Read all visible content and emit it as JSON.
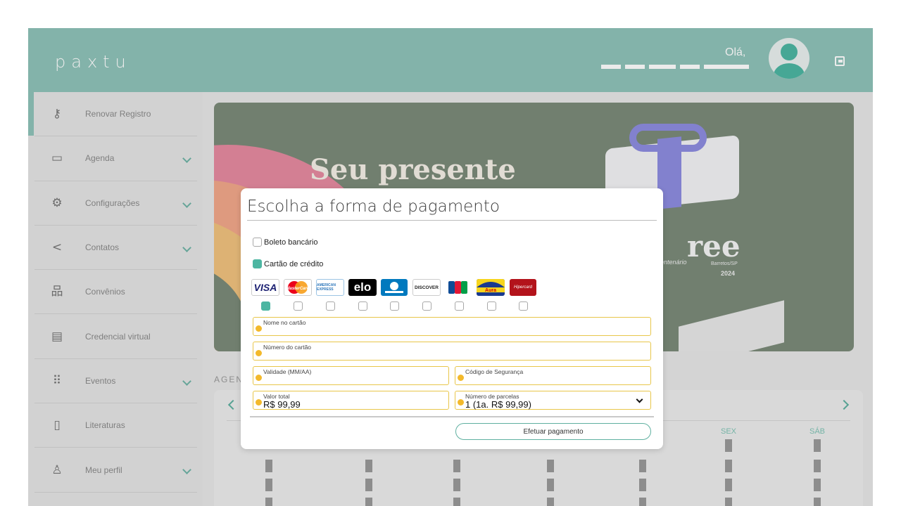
{
  "app": {
    "logo": "paxtu"
  },
  "header": {
    "greeting": "Olá,"
  },
  "sidebar": {
    "items": [
      {
        "label": "Renovar Registro",
        "icon": "key-icon",
        "glyph": "⚷",
        "expandable": false,
        "active": true
      },
      {
        "label": "Agenda",
        "icon": "calendar-icon",
        "glyph": "▭",
        "expandable": true
      },
      {
        "label": "Configurações",
        "icon": "gear-icon",
        "glyph": "⚙",
        "expandable": true
      },
      {
        "label": "Contatos",
        "icon": "share-icon",
        "glyph": "<",
        "expandable": true
      },
      {
        "label": "Convênios",
        "icon": "hierarchy-icon",
        "glyph": "品",
        "expandable": false
      },
      {
        "label": "Credencial virtual",
        "icon": "inbox-icon",
        "glyph": "▤",
        "expandable": false
      },
      {
        "label": "Eventos",
        "icon": "grid-icon",
        "glyph": "⠿",
        "expandable": true
      },
      {
        "label": "Literaturas",
        "icon": "book-icon",
        "glyph": "▯",
        "expandable": false
      },
      {
        "label": "Meu perfil",
        "icon": "user-icon",
        "glyph": "♙",
        "expandable": true
      }
    ]
  },
  "banner": {
    "title": "Seu presente",
    "brand": "ree",
    "sub1": "entenário",
    "sub2": "Barretos/SP",
    "sub3": "2024",
    "colors": {
      "background": "#7b8a79",
      "arc_pink": "#e58aa0",
      "arc_orange": "#f1a88a",
      "arc_yellow": "#f0c27e",
      "ribbon": "#8e8ce0"
    }
  },
  "agenda": {
    "title": "AGEN",
    "days": [
      "SEX",
      "SÁB"
    ]
  },
  "modal": {
    "title": "Escolha a forma de pagamento",
    "options": [
      {
        "label": "Boleto bancário",
        "checked": false
      },
      {
        "label": "Cartão de crédito",
        "checked": true
      }
    ],
    "card_brands": [
      {
        "name": "VISA",
        "icon": "visa-icon",
        "selected": true
      },
      {
        "name": "MasterCard",
        "icon": "mastercard-icon",
        "selected": false
      },
      {
        "name": "AMERICAN EXPRESS",
        "icon": "amex-icon",
        "selected": false
      },
      {
        "name": "elo",
        "icon": "elo-icon",
        "selected": false
      },
      {
        "name": "Diners Club",
        "icon": "diners-icon",
        "selected": false
      },
      {
        "name": "DISCOVER",
        "icon": "discover-icon",
        "selected": false
      },
      {
        "name": "JCB",
        "icon": "jcb-icon",
        "selected": false
      },
      {
        "name": "Aura",
        "icon": "aura-icon",
        "selected": false
      },
      {
        "name": "Hipercard",
        "icon": "hipercard-icon",
        "selected": false
      }
    ],
    "fields": {
      "card_name": {
        "label": "Nome no cartão",
        "value": ""
      },
      "card_number": {
        "label": "Número do cartão",
        "value": ""
      },
      "expiry": {
        "label": "Validade (MM/AA)",
        "value": ""
      },
      "cvv": {
        "label": "Código de Segurança",
        "value": ""
      },
      "total": {
        "label": "Valor total",
        "value": "R$ 99,99"
      },
      "installments": {
        "label": "Número de parcelas",
        "value": "1 (1a. R$ 99,99)"
      }
    },
    "pay_button": "Efetuar pagamento"
  },
  "colors": {
    "primary": "#8fc3b9",
    "accent": "#4db6a2",
    "warning": "#f3b92b"
  }
}
